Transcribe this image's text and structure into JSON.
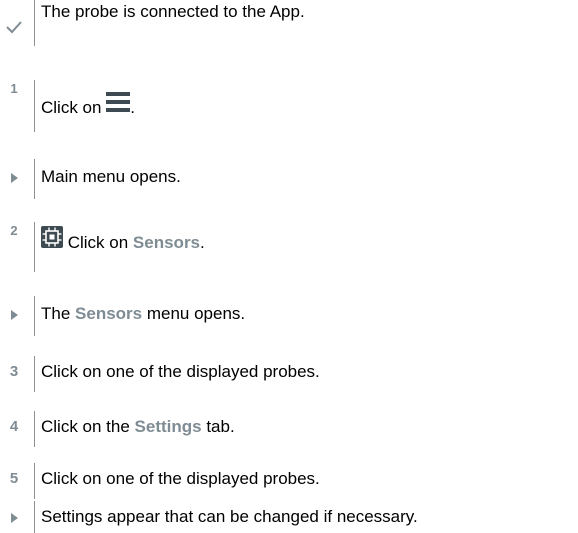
{
  "steps": [
    {
      "marker": "check-icon",
      "parts": [
        "The probe is connected to the App."
      ]
    },
    {
      "marker": "1",
      "parts": [
        "Click on ",
        "."
      ]
    },
    {
      "marker": "result-arrow-icon",
      "parts": [
        "Main menu opens."
      ]
    },
    {
      "marker": "2",
      "parts": [
        " Click on ",
        "Sensors",
        "."
      ]
    },
    {
      "marker": "result-arrow-icon",
      "parts": [
        "The ",
        "Sensors",
        " menu opens."
      ]
    },
    {
      "marker": "3",
      "parts": [
        "Click on one of the displayed probes."
      ]
    },
    {
      "marker": "4",
      "parts": [
        "Click on the ",
        "Settings",
        " tab."
      ]
    },
    {
      "marker": "5",
      "parts": [
        "Click on one of the displayed probes."
      ]
    },
    {
      "marker": "result-arrow-icon",
      "parts": [
        "Settings appear that can be changed if necessary."
      ]
    }
  ],
  "icons": {
    "menu": "hamburger-menu-icon",
    "sensors": "sensor-chip-icon"
  },
  "colors": {
    "accent_gray": "#7f8c94",
    "rule": "#8b9195",
    "check": "#7f8c94"
  }
}
